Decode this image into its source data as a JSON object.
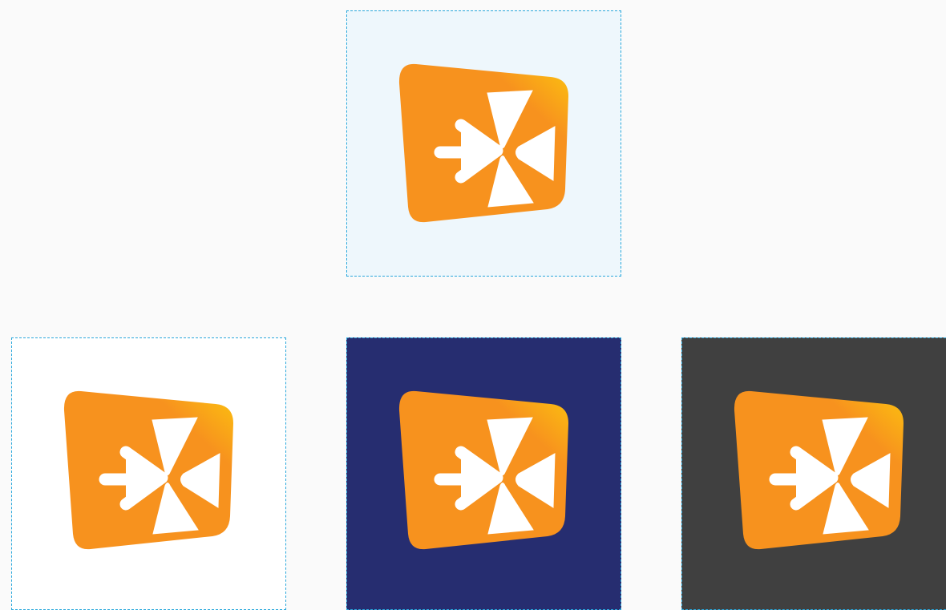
{
  "tiles": [
    {
      "id": "top",
      "background": "#eef7fc",
      "border": "#2aa8dc"
    },
    {
      "id": "white",
      "background": "#ffffff",
      "border": "#2aa8dc"
    },
    {
      "id": "navy",
      "background": "#262d70",
      "border": "#2aa8dc"
    },
    {
      "id": "dark",
      "background": "#404040",
      "border": "#2aa8dc"
    }
  ],
  "logo": {
    "icon": "arrow-burst-logo-icon",
    "gradient_start": "#f7921e",
    "gradient_end": "#fcc30f",
    "glyph_color": "#ffffff"
  }
}
